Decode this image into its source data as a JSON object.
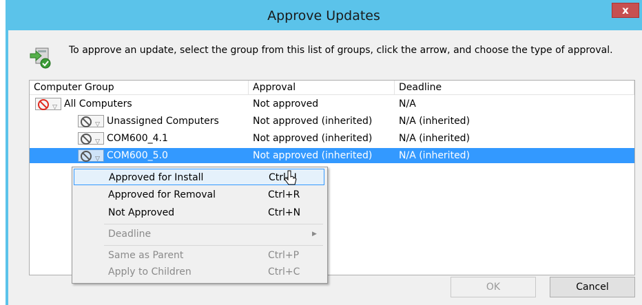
{
  "window": {
    "title": "Approve Updates",
    "close_label": "x"
  },
  "instruction": "To approve an update, select the group from this list of groups, click the arrow, and choose the type of approval.",
  "grid": {
    "headers": [
      "Computer Group",
      "Approval",
      "Deadline"
    ],
    "rows": [
      {
        "group": "All Computers",
        "approval": "Not approved",
        "deadline": "N/A"
      },
      {
        "group": "Unassigned Computers",
        "approval": "Not approved (inherited)",
        "deadline": "N/A (inherited)"
      },
      {
        "group": "COM600_4.1",
        "approval": "Not approved (inherited)",
        "deadline": "N/A (inherited)"
      },
      {
        "group": "COM600_5.0",
        "approval": "Not approved (inherited)",
        "deadline": "N/A (inherited)"
      }
    ]
  },
  "context_menu": {
    "items": [
      {
        "label": "Approved for Install",
        "shortcut": "Ctrl+I"
      },
      {
        "label": "Approved for Removal",
        "shortcut": "Ctrl+R"
      },
      {
        "label": "Not Approved",
        "shortcut": "Ctrl+N"
      },
      {
        "label": "Deadline",
        "shortcut": ""
      },
      {
        "label": "Same as Parent",
        "shortcut": "Ctrl+P"
      },
      {
        "label": "Apply to Children",
        "shortcut": "Ctrl+C"
      }
    ]
  },
  "buttons": {
    "ok": "OK",
    "cancel": "Cancel"
  },
  "colors": {
    "title_bar": "#5bc3ea",
    "selection": "#3399ff",
    "close_button": "#c75050"
  }
}
